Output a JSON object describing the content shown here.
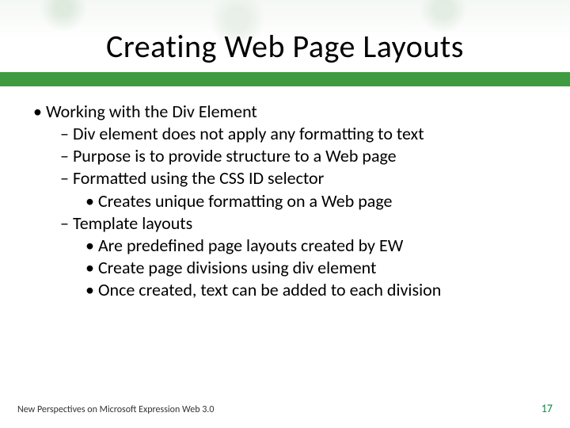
{
  "title": "Creating Web Page Layouts",
  "bullets": {
    "lvl1_1": "Working with the Div Element",
    "lvl2_1": "Div element does not apply any formatting to text",
    "lvl2_2": "Purpose is to provide structure to a Web page",
    "lvl2_3": "Formatted using the CSS ID selector",
    "lvl3_1": "Creates unique formatting on a Web page",
    "lvl2_4": "Template layouts",
    "lvl3_2": "Are predefined page layouts created by EW",
    "lvl3_3": "Create page divisions using div element",
    "lvl3_4": "Once created, text can be added to each division"
  },
  "footer": {
    "source": "New Perspectives on Microsoft Expression Web 3.0",
    "page": "17"
  }
}
